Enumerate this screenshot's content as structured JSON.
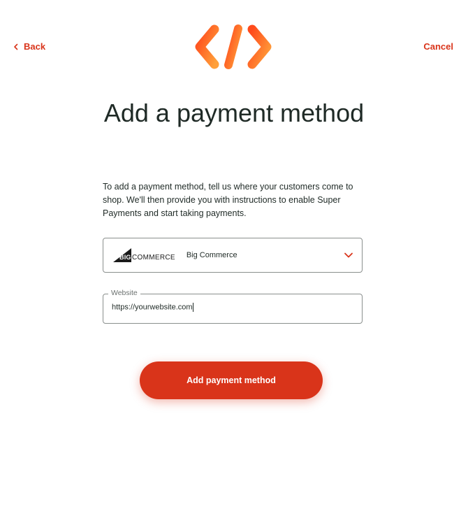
{
  "header": {
    "back_label": "Back",
    "cancel_label": "Cancel"
  },
  "title": "Add a payment method",
  "description": "To add a payment method, tell us where your customers come to shop. We'll then provide you with instructions to enable Super Payments and start taking payments.",
  "platform_select": {
    "logo_text_big": "BIG",
    "logo_text_commerce": "COMMERCE",
    "selected_value": "Big Commerce"
  },
  "website_field": {
    "label": "Website",
    "value": "https://yourwebsite.com"
  },
  "submit_label": "Add payment method",
  "colors": {
    "accent": "#d9341a",
    "logo_gradient_start": "#ff4a1c",
    "logo_gradient_end": "#ffa03a",
    "text": "#1f2a26",
    "border": "#8a8f8d"
  }
}
